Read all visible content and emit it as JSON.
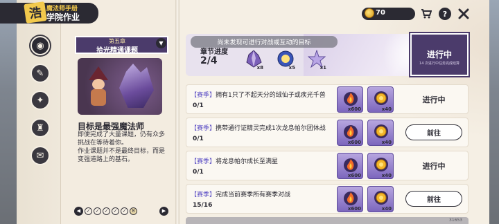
{
  "header": {
    "logo_glyph": "浩",
    "subtitle": "魔法师手册",
    "title": "学院作业"
  },
  "topbar": {
    "currency": "70",
    "shop_icon": "shop-cart-icon",
    "help_icon": "help-icon",
    "close_icon": "close-icon"
  },
  "nav": [
    {
      "icon": "map-icon",
      "active": true
    },
    {
      "icon": "scroll-icon",
      "active": false
    },
    {
      "icon": "star-badge-icon",
      "active": false
    },
    {
      "icon": "trophy-icon",
      "active": false
    },
    {
      "icon": "chat-icon",
      "active": false
    }
  ],
  "chapter": {
    "number_label": "第五章",
    "name": "拾光精通课题",
    "goal_title": "目标是最强魔法师",
    "goal_desc": [
      "即便完成了大量课题，仍有众多",
      "挑战在等待着你。",
      "作业课题并不是最终目标，而是",
      "变强道路上的基石。"
    ]
  },
  "pager": {
    "prev": "◀",
    "next": "▶",
    "dots": [
      "✓",
      "✓",
      "✓",
      "✓",
      "✓",
      "8"
    ]
  },
  "toast": "尚未发现可进行对战或互动的目标",
  "progress": {
    "label": "章节进度",
    "count": "2/4",
    "rewards": [
      {
        "icon": "purple-crystal-icon",
        "qty": "x8"
      },
      {
        "icon": "blue-orb-icon",
        "qty": "x5"
      },
      {
        "icon": "star-creature-icon",
        "qty": "x1"
      }
    ],
    "status": "进行中",
    "status_sub": "14 次进行中任务完成结算"
  },
  "tasks": [
    {
      "season": "【赛季】",
      "desc": "拥有1只了不起天分的绒仙子或疾光千兽",
      "progress": "0/1",
      "rewards": [
        {
          "icon": "fire-essence-icon",
          "qty": "x600"
        },
        {
          "icon": "gold-coin-icon",
          "qty": "x40"
        }
      ],
      "status": "进行中",
      "has_goto": false
    },
    {
      "season": "【赛季】",
      "desc": "携带通行证精灵完成1次龙息帕尔团体战",
      "progress": "0/1",
      "rewards": [
        {
          "icon": "fire-essence-icon",
          "qty": "x600"
        },
        {
          "icon": "gold-coin-icon",
          "qty": "x40"
        }
      ],
      "status": "前往",
      "has_goto": true
    },
    {
      "season": "【赛季】",
      "desc": "将龙息帕尔成长至满星",
      "progress": "0/1",
      "rewards": [
        {
          "icon": "fire-essence-icon",
          "qty": "x600"
        },
        {
          "icon": "gold-coin-icon",
          "qty": "x40"
        }
      ],
      "status": "进行中",
      "has_goto": false
    },
    {
      "season": "【赛季】",
      "desc": "完成当前赛季所有赛季对战",
      "progress": "15/16",
      "rewards": [
        {
          "icon": "fire-essence-icon",
          "qty": "x600"
        },
        {
          "icon": "gold-coin-icon",
          "qty": "x40"
        }
      ],
      "status": "前往",
      "has_goto": true
    }
  ],
  "version": "31653"
}
